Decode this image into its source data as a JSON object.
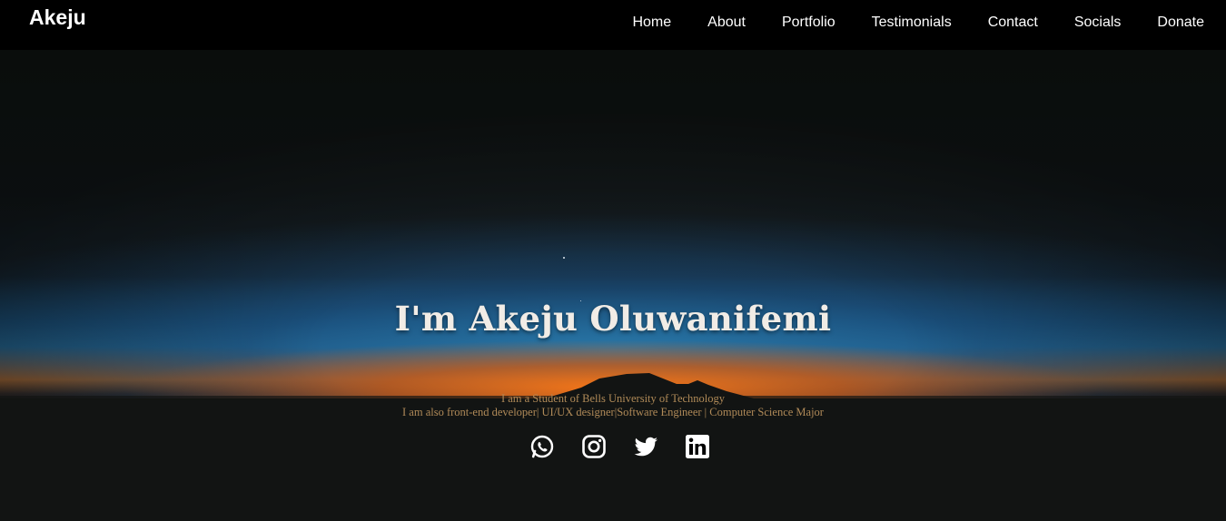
{
  "navbar": {
    "brand": "Akeju",
    "links": [
      "Home",
      "About",
      "Portfolio",
      "Testimonials",
      "Contact",
      "Socials",
      "Donate"
    ]
  },
  "hero": {
    "headline": "I'm Akeju Oluwanifemi",
    "line1": "I am a Student of Bells University of Technology",
    "line2": "I am also front-end developer| UI/UX designer|Software Engineer | Computer Science Major",
    "socials": [
      "whatsapp-icon",
      "instagram-icon",
      "twitter-icon",
      "linkedin-icon"
    ]
  },
  "colors": {
    "navbar_bg": "#000000",
    "nav_text": "#ffffff",
    "headline": "#f1ece6",
    "subtext": "#b08a58",
    "sunset_orange": "#e07a1a",
    "sky_blue": "#2a6e96"
  }
}
